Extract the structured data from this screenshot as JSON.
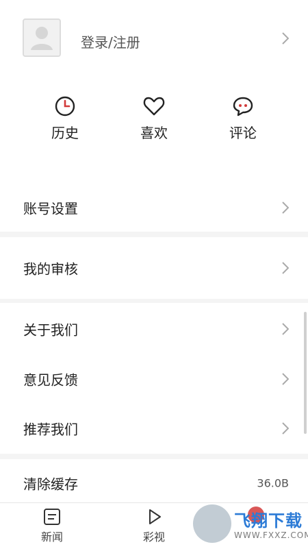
{
  "profile": {
    "login_label": "登录/注册"
  },
  "quick_actions": [
    {
      "label": "历史",
      "icon": "clock-icon"
    },
    {
      "label": "喜欢",
      "icon": "heart-icon"
    },
    {
      "label": "评论",
      "icon": "comment-icon"
    }
  ],
  "settings": {
    "account": "账号设置",
    "review": "我的审核",
    "about": "关于我们",
    "feedback": "意见反馈",
    "recommend": "推荐我们",
    "clear_cache": "清除缓存",
    "cache_size": "36.0B"
  },
  "tabs": [
    {
      "label": "新闻",
      "icon": "news-icon"
    },
    {
      "label": "彩视",
      "icon": "play-icon"
    }
  ],
  "watermark": {
    "brand": "飞翔下载",
    "url": "WWW.FXXZ.COM"
  },
  "colors": {
    "accent_red": "#d23a3a",
    "background": "#f4f4f4"
  }
}
